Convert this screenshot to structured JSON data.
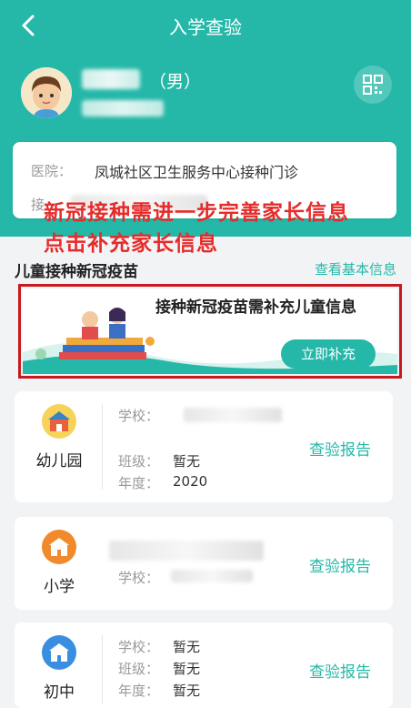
{
  "nav": {
    "title": "入学查验",
    "back_icon": "chevron-left-icon"
  },
  "profile": {
    "gender": "（男）",
    "qr_icon": "qr-code-icon"
  },
  "info": {
    "hospital_label": "医院：",
    "hospital_value": "凤城社区卫生服务中心接种门诊",
    "row2_label": "接"
  },
  "annotation": {
    "line1": "新冠接种需进一步完善家长信息",
    "line2": "点击补充家长信息",
    "color": "#e62b2b"
  },
  "section": {
    "title": "儿童接种新冠疫苗",
    "link": "查看基本信息"
  },
  "banner": {
    "title": "接种新冠疫苗需补充儿童信息",
    "button": "立即补充"
  },
  "schools": [
    {
      "level": "幼儿园",
      "icon": "kindergarten-icon",
      "school_label": "学校：",
      "class_label": "班级：",
      "class_value": "暂无",
      "year_label": "年度：",
      "year_value": "2020",
      "report": "查验报告"
    },
    {
      "level": "小学",
      "icon": "primary-school-icon",
      "school_label": "学校：",
      "report": "查验报告"
    },
    {
      "level": "初中",
      "icon": "middle-school-icon",
      "school_label": "学校：",
      "school_value": "暂无",
      "class_label": "班级：",
      "class_value": "暂无",
      "year_label": "年度：",
      "year_value": "暂无",
      "report": "查验报告"
    }
  ],
  "colors": {
    "accent": "#25b8a8",
    "outline": "#c8191e"
  }
}
